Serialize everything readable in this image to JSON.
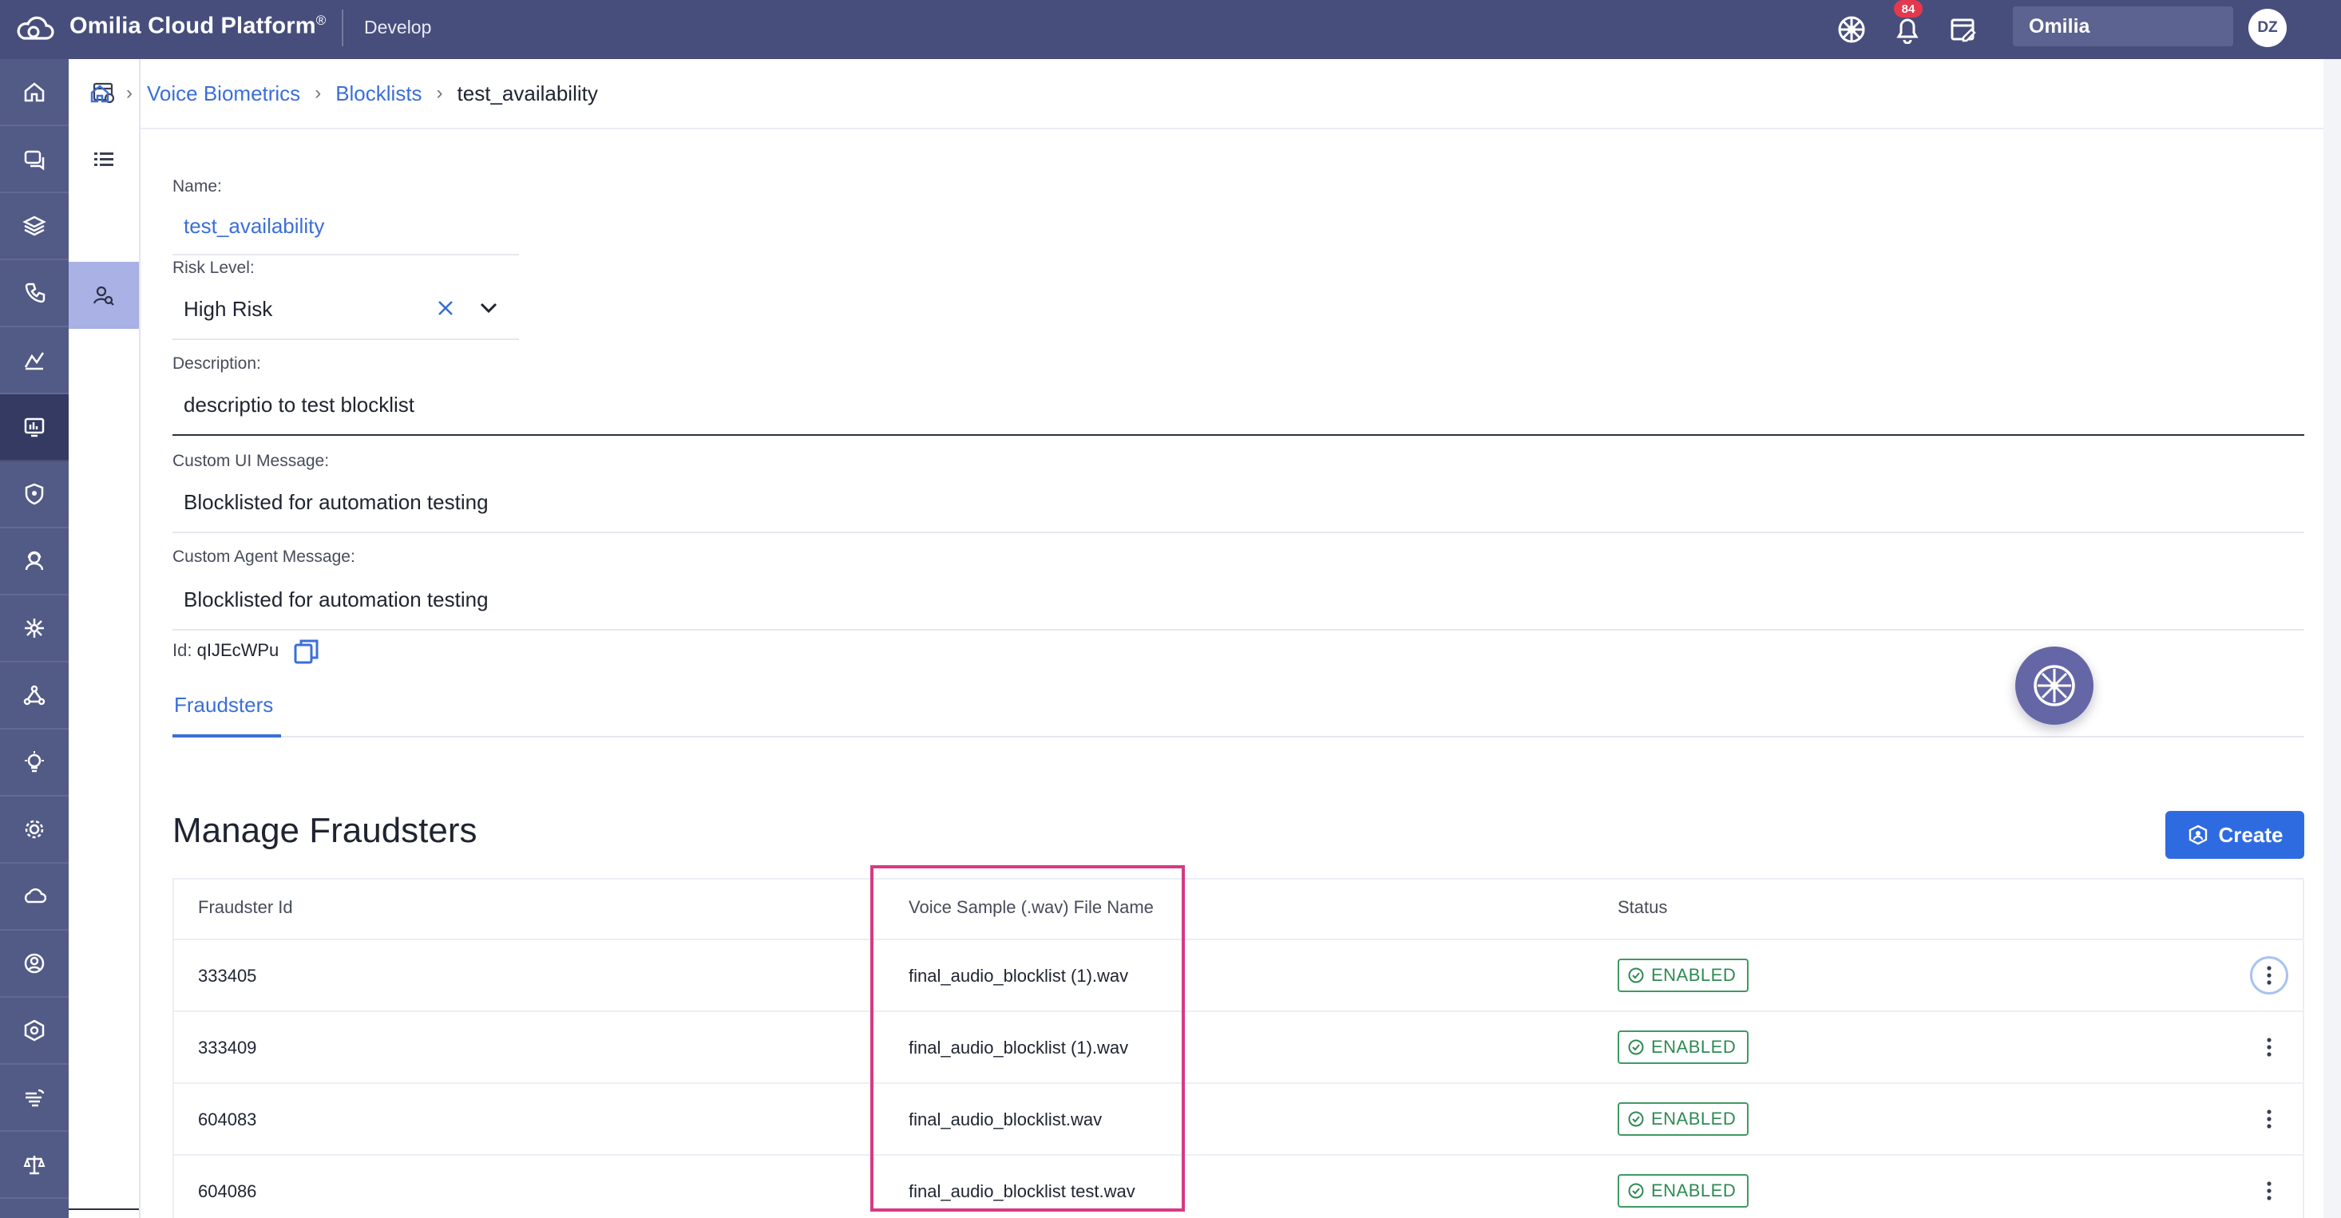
{
  "topbar": {
    "brand": "Omilia Cloud Platform",
    "brand_mark": "®",
    "environment": "Develop",
    "notifications_count": "84",
    "org_name": "Omilia",
    "user_initials": "DZ",
    "icons": [
      "cloud-logo-icon",
      "support-wheel-icon",
      "bell-icon",
      "release-notes-icon"
    ]
  },
  "rail": {
    "icons": [
      "home-icon",
      "chat-icon",
      "layers-icon",
      "call-icon",
      "analytics-icon",
      "voice-biometrics-icon",
      "shield-icon",
      "agent-icon",
      "network-icon",
      "graph-icon",
      "insights-icon",
      "settings-icon",
      "cloud-icon",
      "admin-icon",
      "hexagon-settings-icon",
      "speech-icon",
      "legal-icon"
    ],
    "active_index": 5
  },
  "subnav": {
    "icons": [
      "dashboard-settings-icon",
      "list-icon",
      "user-search-icon"
    ],
    "active_index": 2
  },
  "breadcrumb": {
    "items": [
      "Voice Biometrics",
      "Blocklists"
    ],
    "current": "test_availability"
  },
  "form": {
    "name_label": "Name:",
    "name_value": "test_availability",
    "risk_label": "Risk Level:",
    "risk_value": "High Risk",
    "description_label": "Description:",
    "description_value": "descriptio to test blocklist",
    "ui_message_label": "Custom UI Message:",
    "ui_message_value": "Blocklisted for automation testing",
    "agent_message_label": "Custom Agent Message:",
    "agent_message_value": "Blocklisted for automation testing",
    "id_label": "Id:",
    "id_value": "qIJEcWPu"
  },
  "tabs": [
    "Fraudsters"
  ],
  "manage": {
    "title": "Manage Fraudsters",
    "create_label": "Create"
  },
  "table": {
    "columns": [
      "Fraudster Id",
      "Voice Sample (.wav) File Name",
      "Status"
    ],
    "rows": [
      {
        "id": "333405",
        "file": "final_audio_blocklist (1).wav",
        "status": "ENABLED"
      },
      {
        "id": "333409",
        "file": "final_audio_blocklist (1).wav",
        "status": "ENABLED"
      },
      {
        "id": "604083",
        "file": "final_audio_blocklist.wav",
        "status": "ENABLED"
      },
      {
        "id": "604086",
        "file": "final_audio_blocklist test.wav",
        "status": "ENABLED"
      }
    ]
  },
  "colors": {
    "topbar": "#474e7c",
    "rail": "#525a86",
    "rail_active": "#343a62",
    "accent": "#3a6fd8",
    "status_green": "#2e8a54",
    "highlight": "#d53a84"
  }
}
